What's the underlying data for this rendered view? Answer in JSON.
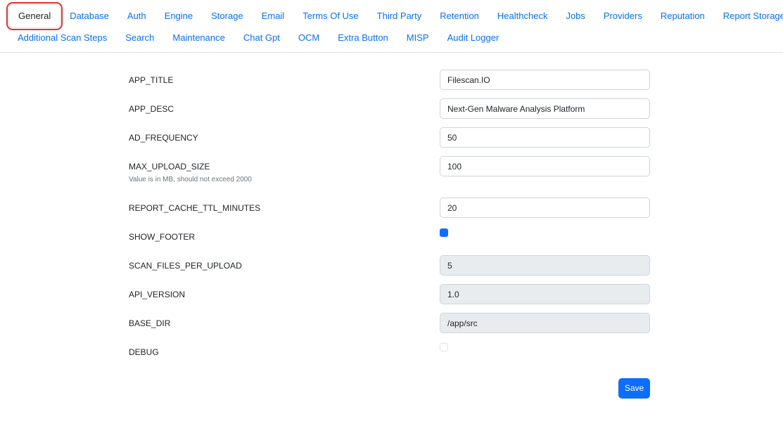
{
  "tabs": {
    "row1": [
      "General",
      "Database",
      "Auth",
      "Engine",
      "Storage",
      "Email",
      "Terms Of Use",
      "Third Party",
      "Retention",
      "Healthcheck",
      "Jobs",
      "Providers",
      "Reputation",
      "Report Storage"
    ],
    "row2": [
      "Additional Scan Steps",
      "Search",
      "Maintenance",
      "Chat Gpt",
      "OCM",
      "Extra Button",
      "MISP",
      "Audit Logger"
    ],
    "active": "General"
  },
  "fields": {
    "app_title": {
      "label": "APP_TITLE",
      "value": "Filescan.IO"
    },
    "app_desc": {
      "label": "APP_DESC",
      "value": "Next-Gen Malware Analysis Platform"
    },
    "ad_frequency": {
      "label": "AD_FREQUENCY",
      "value": "50"
    },
    "max_upload_size": {
      "label": "MAX_UPLOAD_SIZE",
      "hint": "Value is in MB, should not exceed 2000",
      "value": "100"
    },
    "report_cache_ttl": {
      "label": "REPORT_CACHE_TTL_MINUTES",
      "value": "20"
    },
    "show_footer": {
      "label": "SHOW_FOOTER",
      "checked": true
    },
    "scan_files_per_upload": {
      "label": "SCAN_FILES_PER_UPLOAD",
      "value": "5"
    },
    "api_version": {
      "label": "API_VERSION",
      "value": "1.0"
    },
    "base_dir": {
      "label": "BASE_DIR",
      "value": "/app/src"
    },
    "debug": {
      "label": "DEBUG",
      "checked": false
    }
  },
  "actions": {
    "save_label": "Save"
  },
  "colors": {
    "accent": "#0d6efd",
    "active_tab_outline": "#e03131",
    "disabled_bg": "#e9ecef"
  }
}
